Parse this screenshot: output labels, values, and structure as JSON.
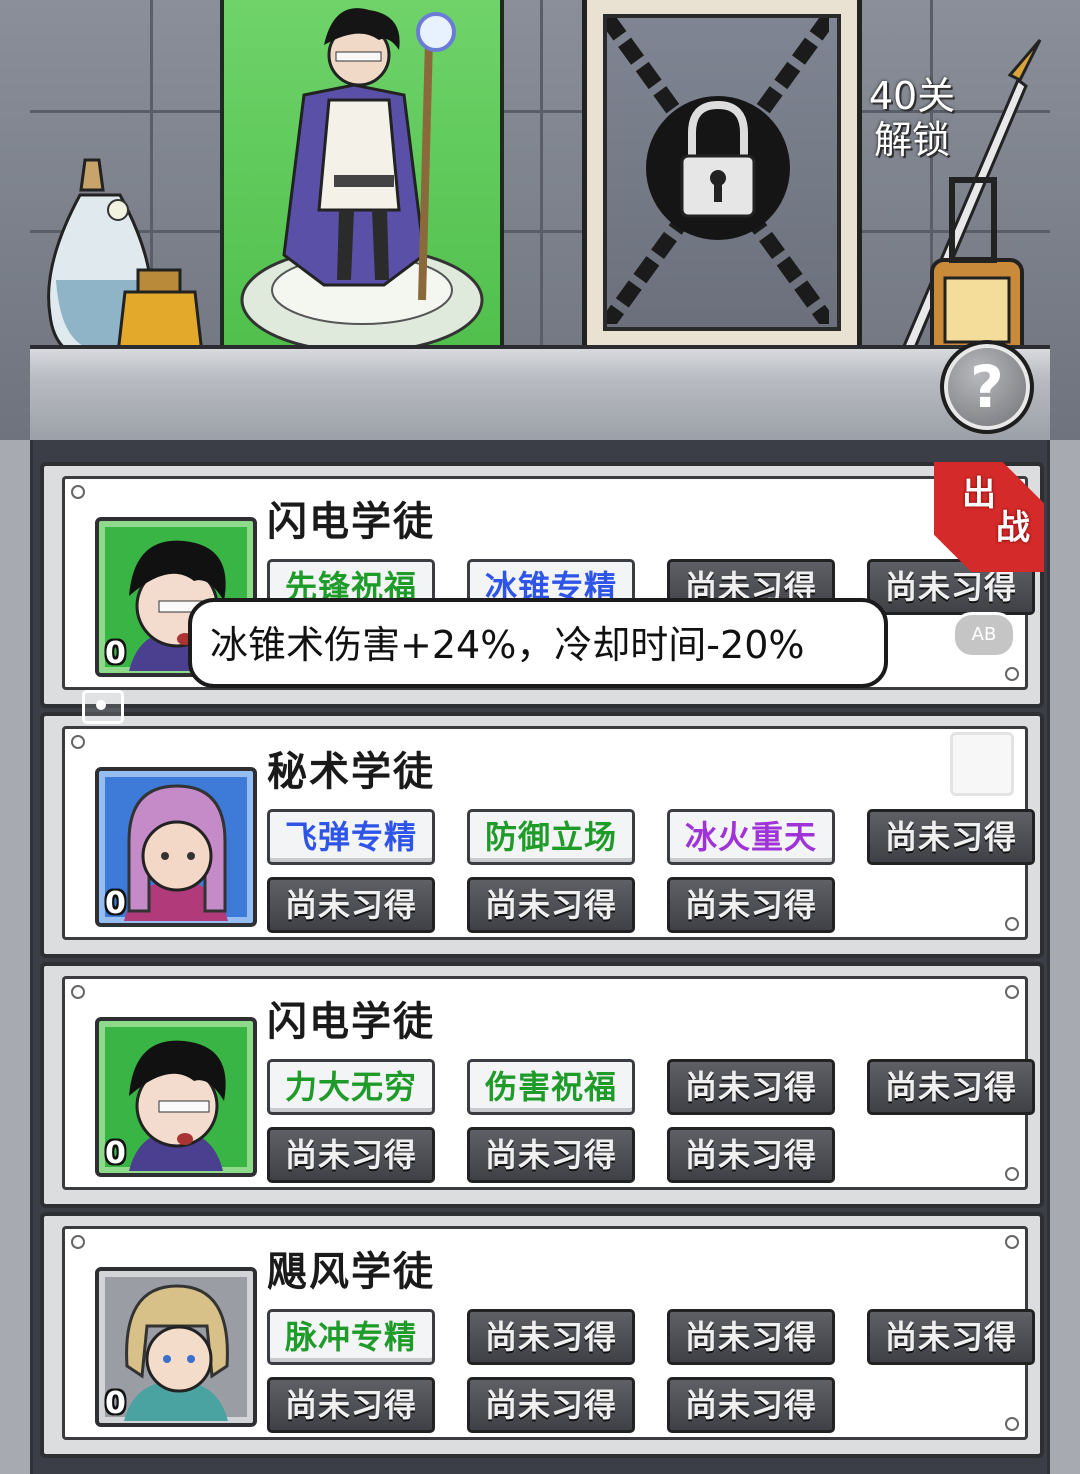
{
  "showcase": {
    "unlock_line1": "40关",
    "unlock_line2": "解锁",
    "help_label": "?"
  },
  "heroes": [
    {
      "name": "闪电学徒",
      "level": "0",
      "portrait_color": "green",
      "deployed_label_1": "出",
      "deployed_label_2": "战",
      "skills": [
        {
          "label": "先锋祝福",
          "color": "green"
        },
        {
          "label": "冰锥专精",
          "color": "blue"
        },
        {
          "label": "尚未习得",
          "color": "locked"
        },
        {
          "label": "尚未习得",
          "color": "locked"
        }
      ],
      "tooltip": "冰锥术伤害+24%，冷却时间-20%"
    },
    {
      "name": "秘术学徒",
      "level": "0",
      "portrait_color": "blue",
      "skills": [
        {
          "label": "飞弹专精",
          "color": "blue"
        },
        {
          "label": "防御立场",
          "color": "green"
        },
        {
          "label": "冰火重天",
          "color": "purple"
        },
        {
          "label": "尚未习得",
          "color": "locked"
        },
        {
          "label": "尚未习得",
          "color": "locked"
        },
        {
          "label": "尚未习得",
          "color": "locked"
        },
        {
          "label": "尚未习得",
          "color": "locked"
        }
      ]
    },
    {
      "name": "闪电学徒",
      "level": "0",
      "portrait_color": "green",
      "skills": [
        {
          "label": "力大无穷",
          "color": "green"
        },
        {
          "label": "伤害祝福",
          "color": "green"
        },
        {
          "label": "尚未习得",
          "color": "locked"
        },
        {
          "label": "尚未习得",
          "color": "locked"
        },
        {
          "label": "尚未习得",
          "color": "locked"
        },
        {
          "label": "尚未习得",
          "color": "locked"
        },
        {
          "label": "尚未习得",
          "color": "locked"
        }
      ]
    },
    {
      "name": "飓风学徒",
      "level": "0",
      "portrait_color": "gray",
      "skills": [
        {
          "label": "脉冲专精",
          "color": "green"
        },
        {
          "label": "尚未习得",
          "color": "locked"
        },
        {
          "label": "尚未习得",
          "color": "locked"
        },
        {
          "label": "尚未习得",
          "color": "locked"
        },
        {
          "label": "尚未习得",
          "color": "locked"
        },
        {
          "label": "尚未习得",
          "color": "locked"
        },
        {
          "label": "尚未习得",
          "color": "locked"
        }
      ]
    }
  ],
  "overlay": {
    "ab_badge": "AB"
  }
}
